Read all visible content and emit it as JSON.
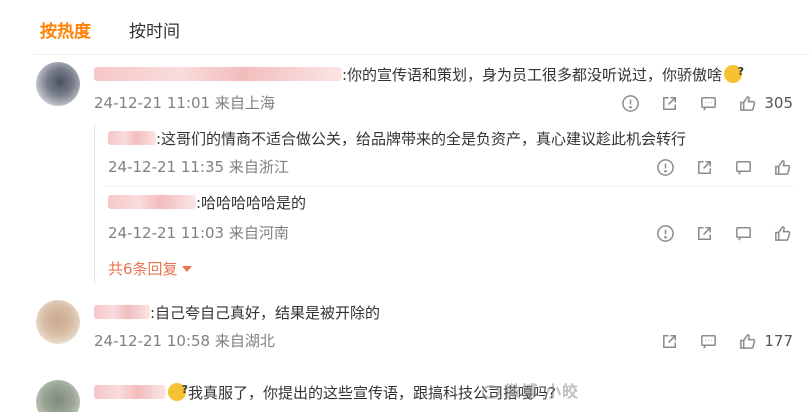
{
  "tabs": {
    "hot": "按热度",
    "time": "按时间"
  },
  "comments": [
    {
      "text": ":你的宣传语和策划，身为员工很多都没听说过，你骄傲啥",
      "meta": "24-12-21 11:01 来自上海",
      "likes": "305"
    },
    {
      "text": ":自己夸自己真好，结果是被开除的",
      "meta": "24-12-21 10:58 来自湖北",
      "likes": "177"
    },
    {
      "text": "我真服了，你提出的这些宣传语，跟搞科技公司搭嘎吗?"
    }
  ],
  "replies": [
    {
      "text": ":这哥们的情商不适合做公关，给品牌带来的全是负资产，真心建议趁此机会转行",
      "meta": "24-12-21 11:35 来自浙江"
    },
    {
      "text": ":哈哈哈哈哈是的",
      "meta": "24-12-21 11:03 来自河南"
    }
  ],
  "more_replies": "共6条回复",
  "watermark": "微博 小皎",
  "icons": [
    "warning-icon",
    "share-icon",
    "comment-icon",
    "like-icon"
  ],
  "colors": {
    "accent": "#ff8200",
    "reply_link": "#eb7350",
    "meta": "#808080"
  }
}
